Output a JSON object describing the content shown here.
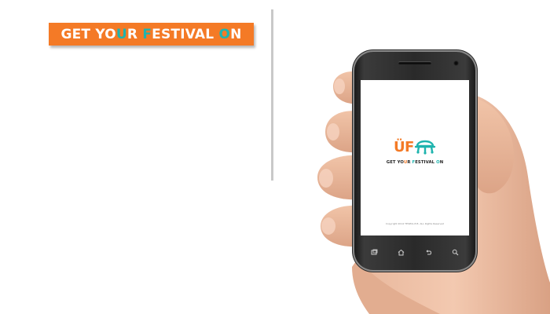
{
  "banner": {
    "part1": "GET YO",
    "u": "U",
    "part2": "R ",
    "f": "F",
    "part3": "ESTIVAL ",
    "o": "O",
    "part4": "N"
  },
  "phone": {
    "logo": {
      "u": "Ü",
      "f": "F"
    },
    "tagline": {
      "part1": "GET YO",
      "u": "U",
      "part2": "R ",
      "f": "F",
      "part3": "ESTIVAL ",
      "o": "O",
      "part4": "N"
    },
    "copyright": "Copyright 2014 TESPOL.E.B. ALL Rights Reserved",
    "nav_icons": [
      "recent-apps-icon",
      "home-icon",
      "back-icon",
      "search-icon"
    ]
  },
  "colors": {
    "orange": "#f47a26",
    "teal": "#1fb4ae",
    "divider": "#c9c9c9",
    "phone_body": "#2a2a2a"
  }
}
